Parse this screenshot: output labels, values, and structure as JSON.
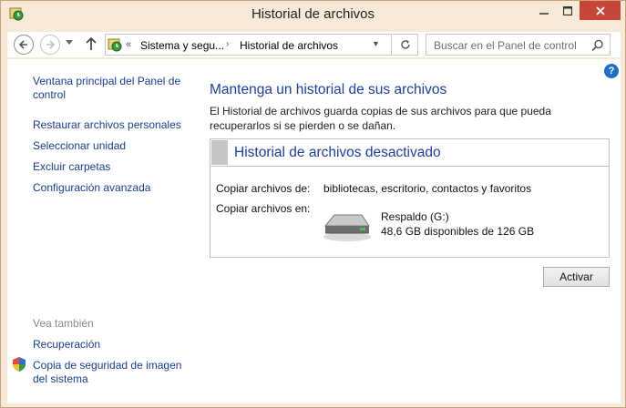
{
  "window": {
    "title": "Historial de archivos"
  },
  "nav": {
    "breadcrumb": [
      "Sistema y segu...",
      "Historial de archivos"
    ],
    "search_placeholder": "Buscar en el Panel de control"
  },
  "sidebar": {
    "links": [
      "Ventana principal del Panel de control",
      "Restaurar archivos personales",
      "Seleccionar unidad",
      "Excluir carpetas",
      "Configuración avanzada"
    ],
    "see_also_heading": "Vea también",
    "see_also": [
      "Recuperación",
      "Copia de seguridad de imagen del sistema"
    ]
  },
  "main": {
    "heading": "Mantenga un historial de sus archivos",
    "description": "El Historial de archivos guarda copias de sus archivos para que pueda recuperarlos si se pierden o se dañan.",
    "panel": {
      "status_title": "Historial de archivos desactivado",
      "copy_label": "Copiar archivos de:",
      "copy_value": "bibliotecas, escritorio, contactos y favoritos",
      "copy_to_label": "Copiar archivos en:",
      "drive_name": "Respaldo (G:)",
      "drive_space": "48,6 GB disponibles de 126 GB"
    },
    "activate_label": "Activar"
  }
}
